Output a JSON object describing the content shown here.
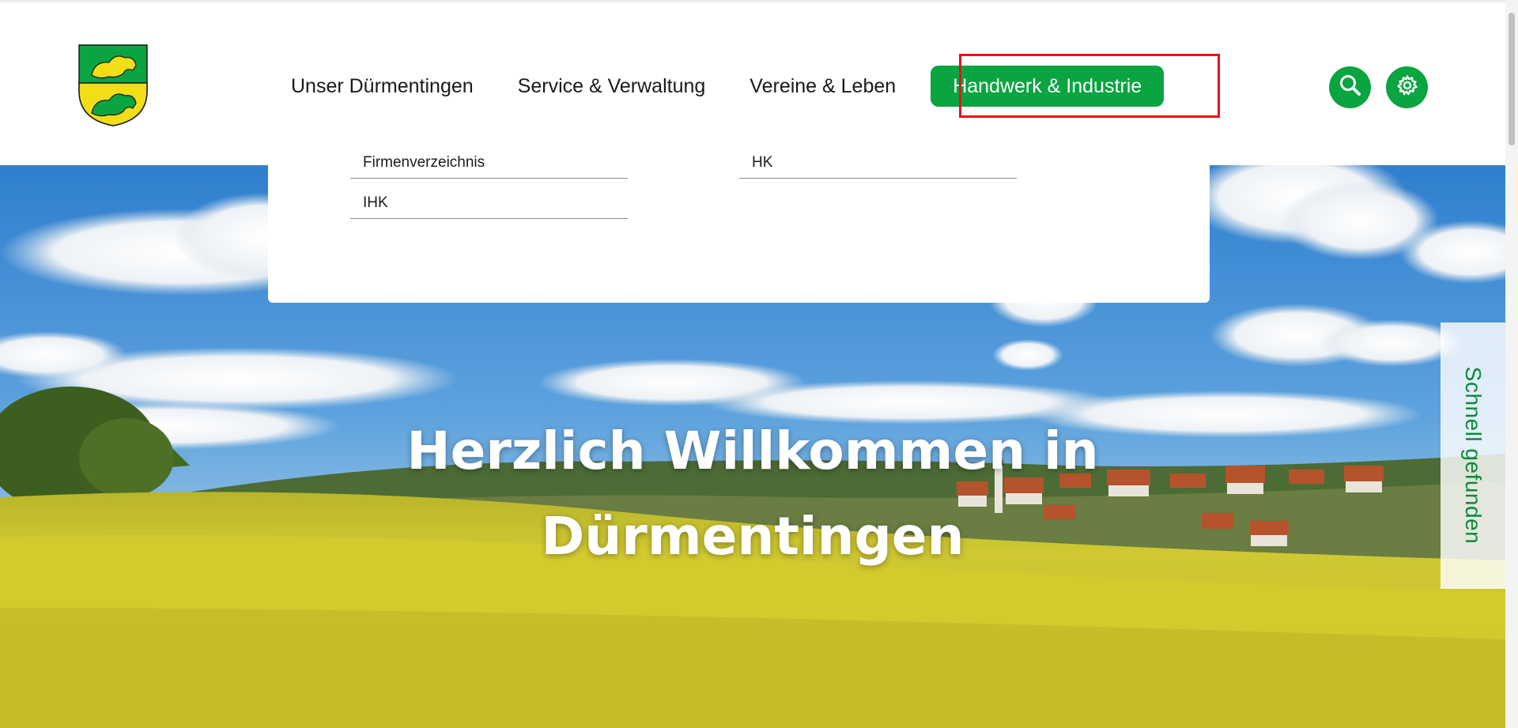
{
  "header": {
    "logo_alt": "Wappen Dürmentingen",
    "nav": [
      {
        "label": "Unser Dürmentingen"
      },
      {
        "label": "Service & Verwaltung"
      },
      {
        "label": "Vereine & Leben"
      },
      {
        "label": "Handwerk & Industrie",
        "active": true
      }
    ],
    "search_icon": "search-icon",
    "settings_icon": "gear-icon"
  },
  "dropdown": {
    "links": [
      {
        "label": "Firmenverzeichnis"
      },
      {
        "label": "HK"
      },
      {
        "label": "IHK"
      }
    ]
  },
  "hero": {
    "title_line1": "Herzlich Willkommen in",
    "title_line2": "Dürmentingen"
  },
  "quick_tab": {
    "label": "Schnell gefunden"
  },
  "colors": {
    "accent": "#0aa441",
    "highlight_outline": "#e2141b",
    "quick_tab_text": "#0a8a3a"
  }
}
